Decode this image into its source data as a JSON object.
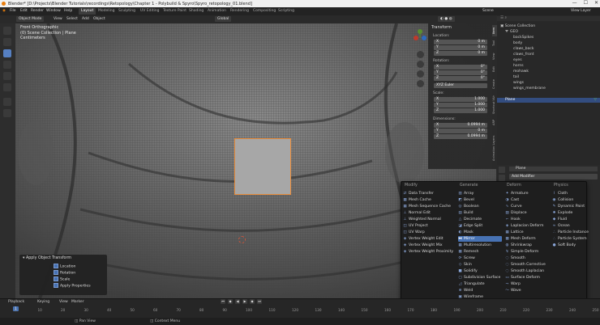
{
  "window": {
    "title": "Blender* [D:\\Projects\\Blender Tutorials\\recordings\\Retopology\\Chapter 1 - Polybuild & Spyro\\Spyro_retopology_01.blend]",
    "minimize": "—",
    "maximize": "☐",
    "close": "✕"
  },
  "menubar": {
    "items": [
      "File",
      "Edit",
      "Render",
      "Window",
      "Help"
    ],
    "workspaces": [
      "Layout",
      "Modeling",
      "Sculpting",
      "UV Editing",
      "Texture Paint",
      "Shading",
      "Animation",
      "Rendering",
      "Compositing",
      "Scripting"
    ],
    "active_workspace": "Layout",
    "scene": "Scene",
    "view_layer": "View Layer"
  },
  "header": {
    "mode": "Object Mode",
    "items": [
      "View",
      "Select",
      "Add",
      "Object"
    ],
    "transform": "Global"
  },
  "viewport": {
    "view_name": "Front Orthographic",
    "collection": "(0) Scene Collection | Plane",
    "units": "Centimeters"
  },
  "npanel": {
    "section": "Transform",
    "location_label": "Location:",
    "location": [
      [
        "X",
        "0 m"
      ],
      [
        "Y",
        "0 m"
      ],
      [
        "Z",
        "0 m"
      ]
    ],
    "rotation_label": "Rotation:",
    "rotation": [
      [
        "X",
        "0°"
      ],
      [
        "Y",
        "0°"
      ],
      [
        "Z",
        "0°"
      ]
    ],
    "euler": "XYZ Euler",
    "scale_label": "Scale:",
    "scale": [
      [
        "X",
        "1.000"
      ],
      [
        "Y",
        "1.000"
      ],
      [
        "Z",
        "1.000"
      ]
    ],
    "dimensions_label": "Dimensions:",
    "dimensions": [
      [
        "X",
        "0.0994 m"
      ],
      [
        "Y",
        "0 m"
      ],
      [
        "Z",
        "0.0994 m"
      ]
    ],
    "tabs": [
      "Item",
      "Tool",
      "View",
      "Edit",
      "Create",
      "Shortcut VUr",
      "ARP",
      "Animation Layers"
    ]
  },
  "outliner": {
    "root": "Scene Collection",
    "items": [
      {
        "label": "GEO",
        "indent": 2
      },
      {
        "label": "backSpikes",
        "indent": 3
      },
      {
        "label": "body",
        "indent": 3
      },
      {
        "label": "claws_back",
        "indent": 3
      },
      {
        "label": "claws_front",
        "indent": 3
      },
      {
        "label": "eyes",
        "indent": 3
      },
      {
        "label": "horns",
        "indent": 3
      },
      {
        "label": "mohawk",
        "indent": 3
      },
      {
        "label": "tail",
        "indent": 3
      },
      {
        "label": "wings",
        "indent": 3
      },
      {
        "label": "wings_membrane",
        "indent": 3
      },
      {
        "label": "Plane",
        "indent": 1,
        "selected": true
      }
    ]
  },
  "properties": {
    "object_name": "Plane",
    "add_modifier": "Add Modifier"
  },
  "modifier_menu": {
    "columns": [
      {
        "title": "Modify",
        "items": [
          "Data Transfer",
          "Mesh Cache",
          "Mesh Sequence Cache",
          "Normal Edit",
          "Weighted Normal",
          "UV Project",
          "UV Warp",
          "Vertex Weight Edit",
          "Vertex Weight Mix",
          "Vertex Weight Proximity"
        ]
      },
      {
        "title": "Generate",
        "items": [
          "Array",
          "Bevel",
          "Boolean",
          "Build",
          "Decimate",
          "Edge Split",
          "Mask",
          "Mirror",
          "Multiresolution",
          "Remesh",
          "Screw",
          "Skin",
          "Solidify",
          "Subdivision Surface",
          "Triangulate",
          "Weld",
          "Wireframe"
        ],
        "highlight": "Mirror"
      },
      {
        "title": "Deform",
        "items": [
          "Armature",
          "Cast",
          "Curve",
          "Displace",
          "Hook",
          "Laplacian Deform",
          "Lattice",
          "Mesh Deform",
          "Shrinkwrap",
          "Simple Deform",
          "Smooth",
          "Smooth Corrective",
          "Smooth Laplacian",
          "Surface Deform",
          "Warp",
          "Wave"
        ]
      },
      {
        "title": "Physics",
        "items": [
          "Cloth",
          "Collision",
          "Dynamic Paint",
          "Explode",
          "Fluid",
          "Ocean",
          "Particle Instance",
          "Particle System",
          "Soft Body"
        ]
      }
    ]
  },
  "apply_panel": {
    "title": "Apply Object Transform",
    "options": [
      "Location",
      "Rotation",
      "Scale",
      "Apply Properties"
    ]
  },
  "timeline": {
    "items": [
      "Playback",
      "Keying",
      "View",
      "Marker"
    ],
    "current_frame": "1",
    "ticks": [
      "0",
      "10",
      "20",
      "30",
      "40",
      "50",
      "60",
      "70",
      "80",
      "90",
      "100",
      "110",
      "120",
      "130",
      "140",
      "150",
      "160",
      "170",
      "180",
      "190",
      "200",
      "210",
      "220",
      "230",
      "240",
      "250"
    ]
  },
  "statusbar": {
    "items": [
      "Pan View",
      "Context Menu"
    ]
  },
  "colors": {
    "accent": "#4772b3",
    "selection_outline": "#e98c3a",
    "mesh_wire": "#3a3a3a",
    "mesh_base": "#6a6a6a"
  }
}
